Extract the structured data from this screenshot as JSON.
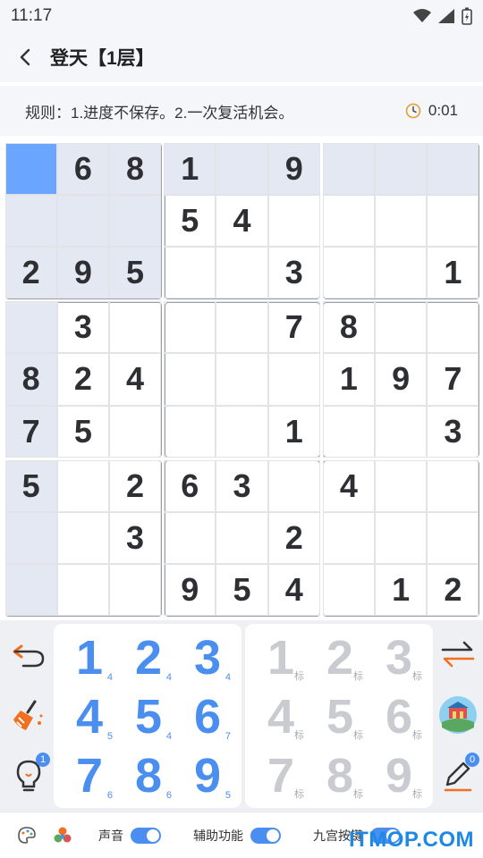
{
  "status": {
    "time": "11:17"
  },
  "header": {
    "title": "登天【1层】"
  },
  "rules": {
    "text": "规则：1.进度不保存。2.一次复活机会。",
    "timer": "0:01"
  },
  "board": {
    "rows": [
      [
        "",
        "6",
        "8",
        "1",
        "",
        "9",
        "",
        "",
        ""
      ],
      [
        "",
        "",
        "",
        "5",
        "4",
        "",
        "",
        "",
        ""
      ],
      [
        "2",
        "9",
        "5",
        "",
        "",
        "3",
        "",
        "",
        "1"
      ],
      [
        "",
        "3",
        "",
        "",
        "",
        "7",
        "8",
        "",
        ""
      ],
      [
        "8",
        "2",
        "4",
        "",
        "",
        "",
        "1",
        "9",
        "7"
      ],
      [
        "7",
        "5",
        "",
        "",
        "",
        "1",
        "",
        "",
        "3"
      ],
      [
        "5",
        "",
        "2",
        "6",
        "3",
        "",
        "4",
        "",
        ""
      ],
      [
        "",
        "",
        "3",
        "",
        "",
        "2",
        "",
        "",
        ""
      ],
      [
        "",
        "",
        "",
        "9",
        "5",
        "4",
        "",
        "1",
        "2"
      ]
    ],
    "selected": [
      0,
      0
    ]
  },
  "keypad": [
    {
      "num": "1",
      "count": "4"
    },
    {
      "num": "2",
      "count": "4"
    },
    {
      "num": "3",
      "count": "4"
    },
    {
      "num": "4",
      "count": "5"
    },
    {
      "num": "5",
      "count": "4"
    },
    {
      "num": "6",
      "count": "7"
    },
    {
      "num": "7",
      "count": "6"
    },
    {
      "num": "8",
      "count": "6"
    },
    {
      "num": "9",
      "count": "5"
    }
  ],
  "notepad": [
    {
      "num": "1",
      "tag": "标"
    },
    {
      "num": "2",
      "tag": "标"
    },
    {
      "num": "3",
      "tag": "标"
    },
    {
      "num": "4",
      "tag": "标"
    },
    {
      "num": "5",
      "tag": "标"
    },
    {
      "num": "6",
      "tag": "标"
    },
    {
      "num": "7",
      "tag": "标"
    },
    {
      "num": "8",
      "tag": "标"
    },
    {
      "num": "9",
      "tag": "标"
    }
  ],
  "tools": {
    "hint_badge": "1",
    "note_badge": "0"
  },
  "footer": {
    "sound_label": "声音",
    "assist_label": "辅助功能",
    "nine_label": "九宫按键",
    "watermark": "ITMOP.COM"
  },
  "colors": {
    "accent": "#4a8ff0",
    "selected_cell": "#6aa6ff",
    "highlight_cell": "#e4e8f2"
  }
}
